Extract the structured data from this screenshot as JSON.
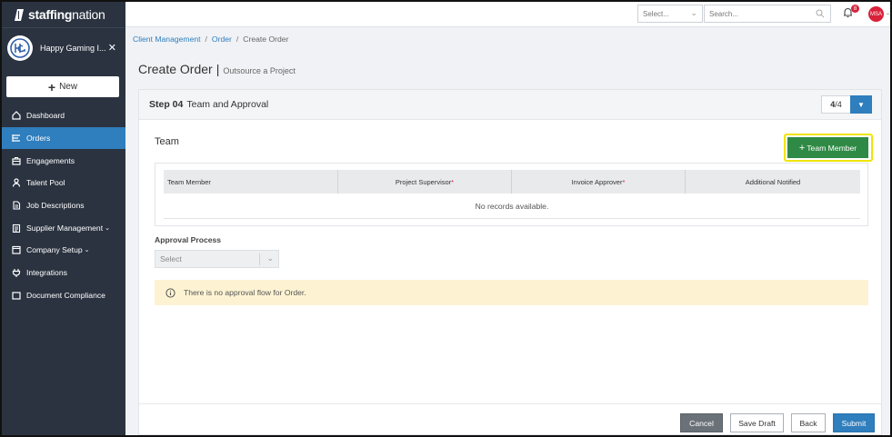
{
  "brand": {
    "name_bold": "staffing",
    "name_light": "nation"
  },
  "client": {
    "name": "Happy Gaming I..."
  },
  "sidebar": {
    "new_label": "New",
    "items": [
      {
        "label": "Dashboard",
        "icon": "home-icon"
      },
      {
        "label": "Orders",
        "icon": "list-icon",
        "active": true
      },
      {
        "label": "Engagements",
        "icon": "briefcase-icon"
      },
      {
        "label": "Talent Pool",
        "icon": "person-icon"
      },
      {
        "label": "Job Descriptions",
        "icon": "document-icon"
      },
      {
        "label": "Supplier Management",
        "icon": "clipboard-icon",
        "has_children": true
      },
      {
        "label": "Company Setup",
        "icon": "window-icon",
        "has_children": true
      },
      {
        "label": "Integrations",
        "icon": "plug-icon"
      },
      {
        "label": "Document Compliance",
        "icon": "folder-icon"
      }
    ]
  },
  "topbar": {
    "select_placeholder": "Select...",
    "search_placeholder": "Search...",
    "notification_count": "8",
    "user_initials": "MSA"
  },
  "breadcrumb": {
    "items": [
      "Client Management",
      "Order",
      "Create Order"
    ]
  },
  "page": {
    "title": "Create Order",
    "subtitle": "Outsource a Project"
  },
  "step": {
    "number": "Step 04",
    "title": "Team and Approval",
    "current": "4",
    "total": "/4"
  },
  "team": {
    "section_title": "Team",
    "add_button": "Team Member",
    "columns": [
      "Team Member",
      "Project Supervisor",
      "Invoice Approver",
      "Additional Notified"
    ],
    "required_mark": "*",
    "empty_text": "No records available."
  },
  "approval": {
    "label": "Approval Process",
    "select_value": "Select",
    "notice": "There is no approval flow for Order."
  },
  "footer": {
    "cancel": "Cancel",
    "save_draft": "Save Draft",
    "back": "Back",
    "submit": "Submit"
  },
  "colors": {
    "accent": "#2f7ebd",
    "sidebar_bg": "#2b3340",
    "success": "#2f8a45",
    "highlight": "#f0e400",
    "notice_bg": "#fdf3d3"
  }
}
